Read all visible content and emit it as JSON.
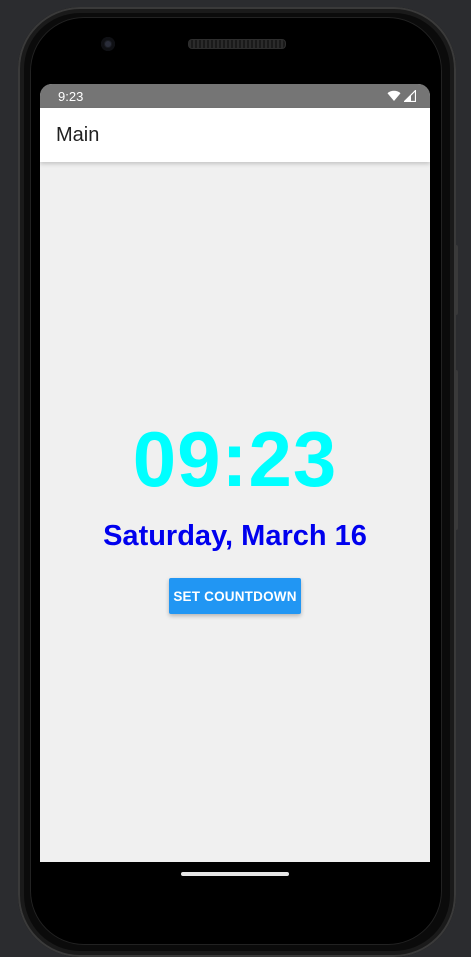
{
  "status_bar": {
    "time": "9:23",
    "wifi_icon": "wifi-icon",
    "signal_icon": "cell-signal-icon"
  },
  "app_bar": {
    "title": "Main"
  },
  "clock": {
    "time": "09:23",
    "date": "Saturday, March 16",
    "time_color": "#00ffff",
    "date_color": "#0000ee"
  },
  "actions": {
    "set_countdown_label": "SET COUNTDOWN",
    "button_color": "#2196f3"
  },
  "device": {
    "home_handle_icon": "home-gesture-handle"
  }
}
